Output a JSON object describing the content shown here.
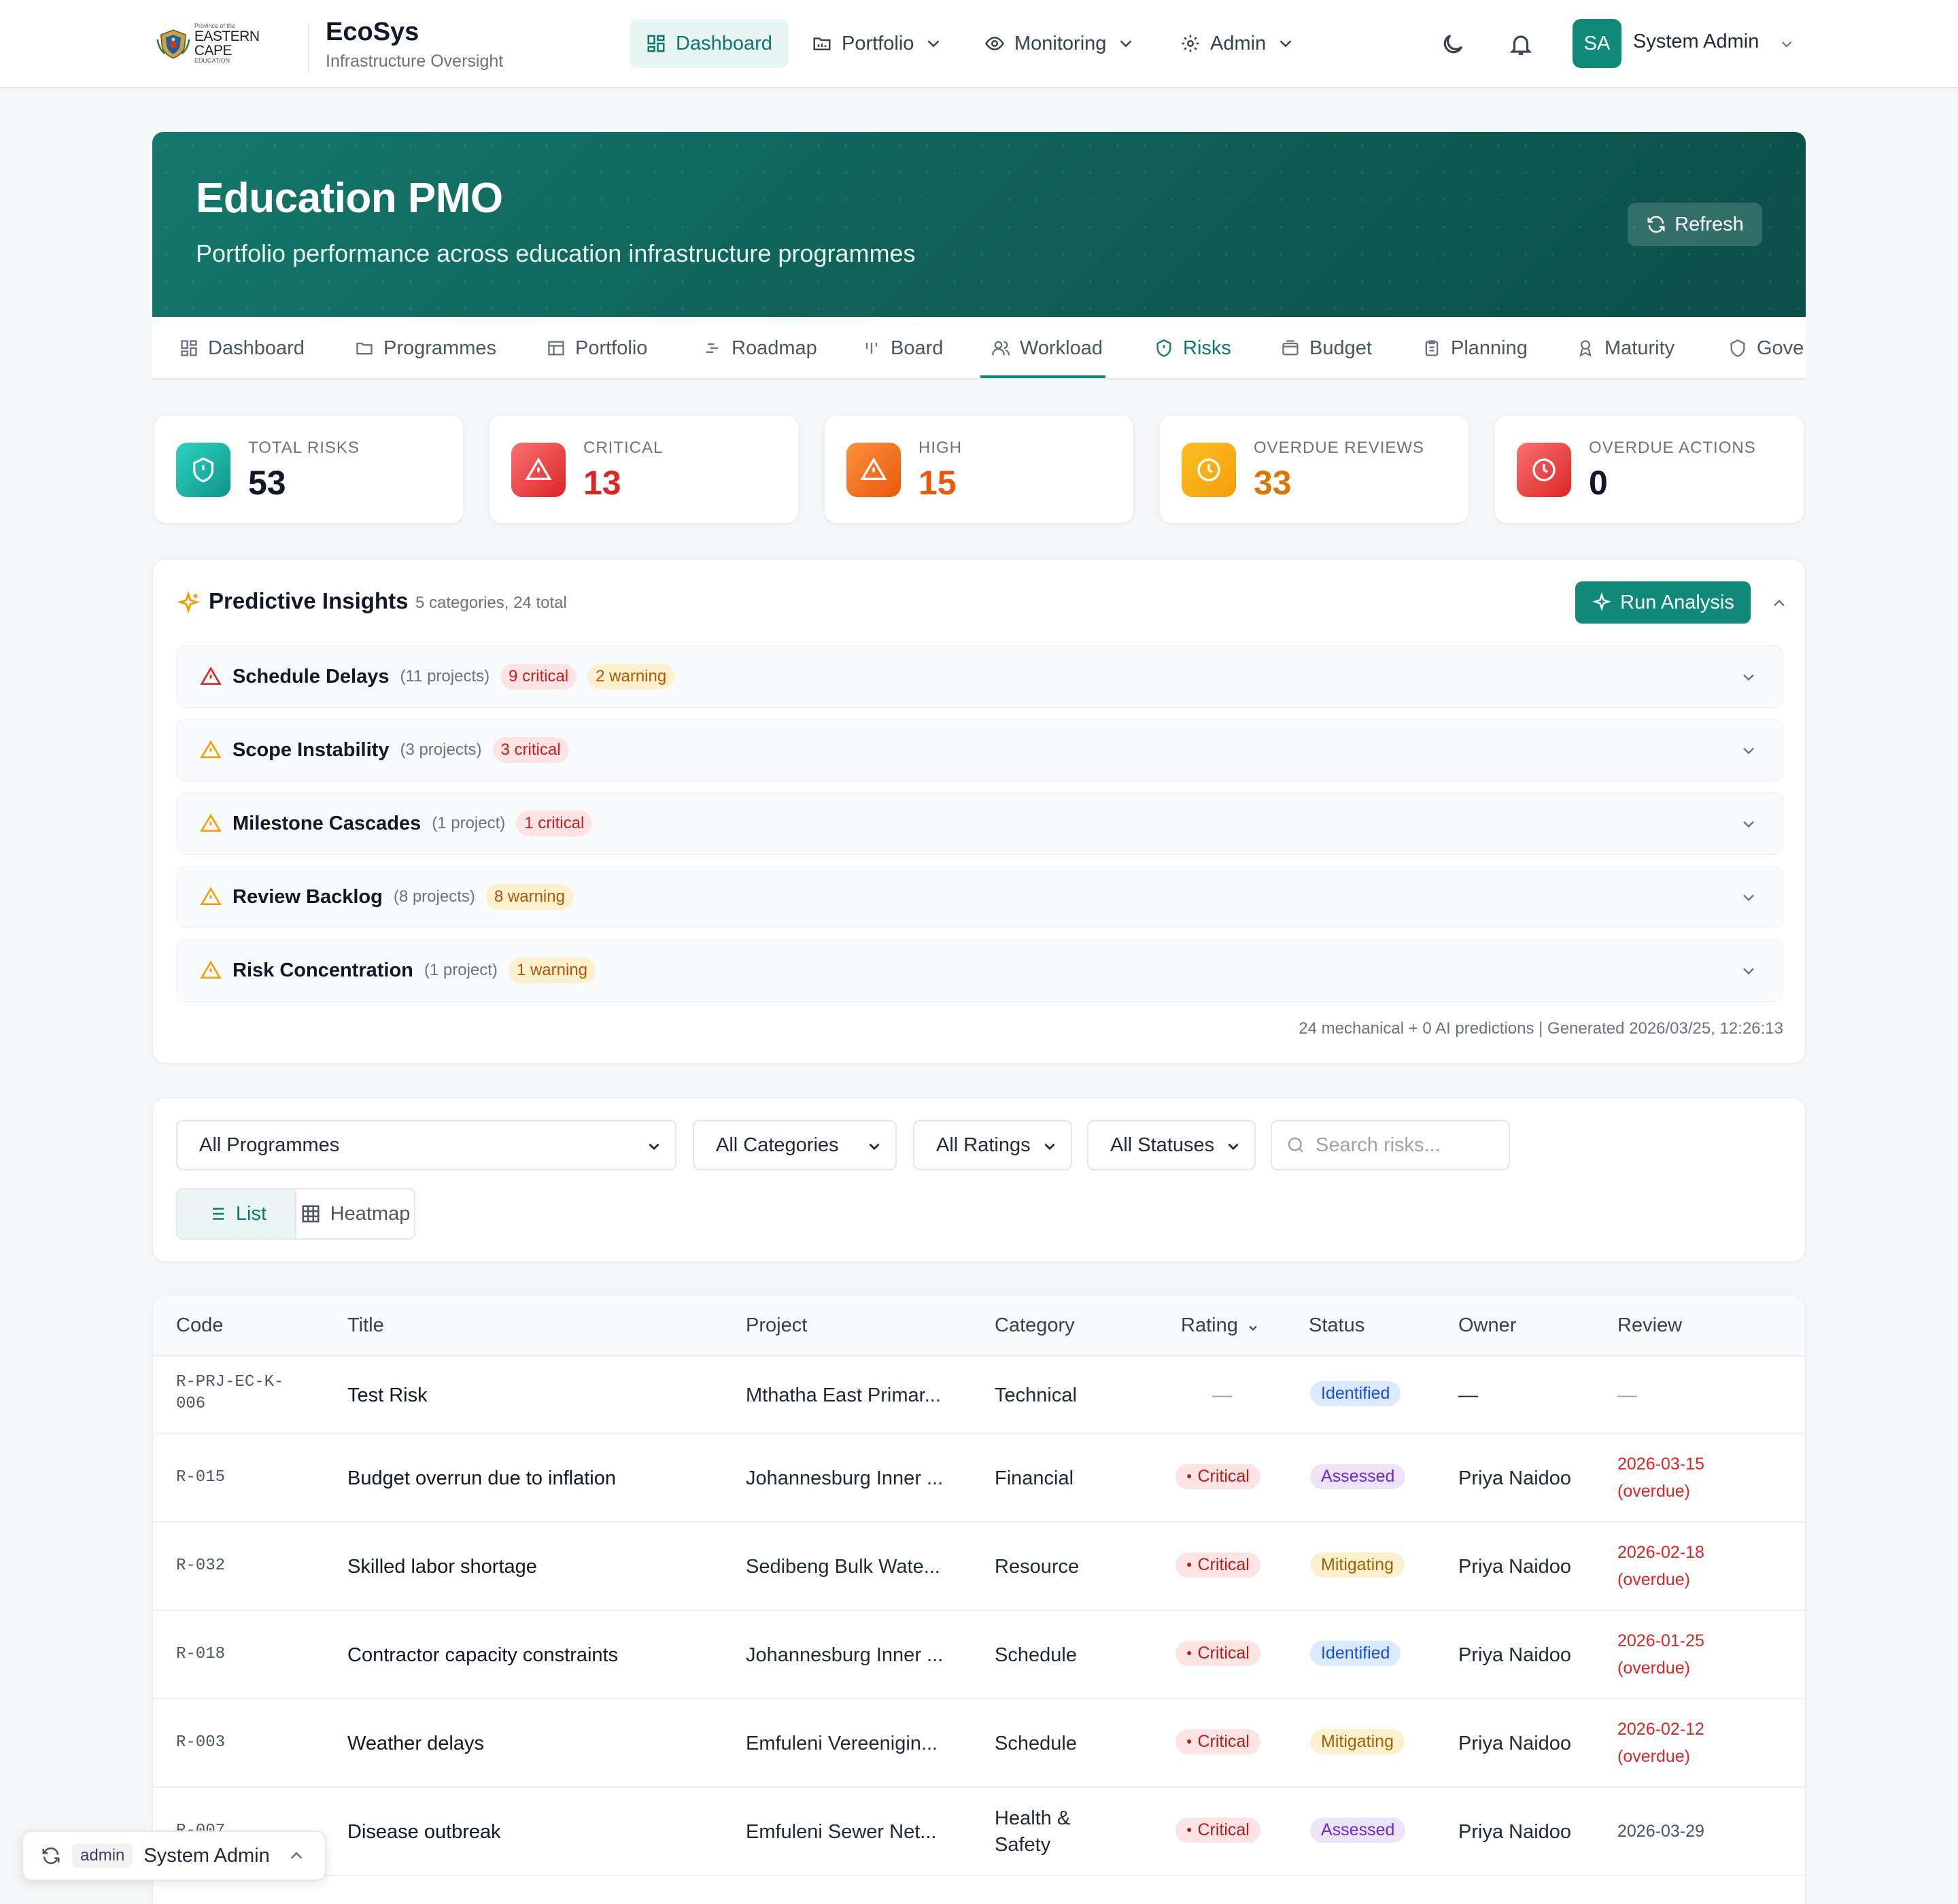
{
  "header": {
    "logo": {
      "line1": "Province of the",
      "line2": "EASTERN CAPE",
      "line3": "EDUCATION"
    },
    "brand": "EcoSys",
    "brand_sub": "Infrastructure Oversight",
    "nav": [
      {
        "label": "Dashboard",
        "icon": "grid-icon",
        "active": true
      },
      {
        "label": "Portfolio",
        "icon": "folder-icon"
      },
      {
        "label": "Monitoring",
        "icon": "eye-icon"
      },
      {
        "label": "Admin",
        "icon": "gear-icon"
      }
    ],
    "user": {
      "initials": "SA",
      "name": "System Admin"
    }
  },
  "hero": {
    "title": "Education PMO",
    "subtitle": "Portfolio performance across education infrastructure programmes",
    "refresh_label": "Refresh"
  },
  "subtabs": [
    {
      "label": "Dashboard",
      "icon": "grid-icon"
    },
    {
      "label": "Programmes",
      "icon": "folder-icon"
    },
    {
      "label": "Portfolio",
      "icon": "table-icon"
    },
    {
      "label": "Roadmap",
      "icon": "roadmap-icon"
    },
    {
      "label": "Board",
      "icon": "board-icon"
    },
    {
      "label": "Workload",
      "icon": "users-icon"
    },
    {
      "label": "Risks",
      "icon": "shield-icon",
      "active": true
    },
    {
      "label": "Budget",
      "icon": "wallet-icon"
    },
    {
      "label": "Planning",
      "icon": "clipboard-icon"
    },
    {
      "label": "Maturity",
      "icon": "award-icon"
    },
    {
      "label": "Gove",
      "icon": "shield-icon"
    }
  ],
  "stats": [
    {
      "label": "TOTAL RISKS",
      "value": "53",
      "color": "#14b8a6"
    },
    {
      "label": "CRITICAL",
      "value": "13",
      "color": "#ef4444"
    },
    {
      "label": "HIGH",
      "value": "15",
      "color": "#f97316"
    },
    {
      "label": "OVERDUE REVIEWS",
      "value": "33",
      "color": "#f59e0b"
    },
    {
      "label": "OVERDUE ACTIONS",
      "value": "0",
      "color": "#ef4444"
    }
  ],
  "insights": {
    "title": "Predictive Insights",
    "meta": "5 categories, 24 total",
    "run_label": "Run Analysis",
    "rows": [
      {
        "title": "Schedule Delays",
        "count": "(11 projects)",
        "critical": "9 critical",
        "warning": "2 warning",
        "severity": "critical"
      },
      {
        "title": "Scope Instability",
        "count": "(3 projects)",
        "critical": "3 critical",
        "warning": "",
        "severity": "warning"
      },
      {
        "title": "Milestone Cascades",
        "count": "(1 project)",
        "critical": "1 critical",
        "warning": "",
        "severity": "warning"
      },
      {
        "title": "Review Backlog",
        "count": "(8 projects)",
        "critical": "",
        "warning": "8 warning",
        "severity": "warning"
      },
      {
        "title": "Risk Concentration",
        "count": "(1 project)",
        "critical": "",
        "warning": "1 warning",
        "severity": "warning"
      }
    ],
    "footer": "24 mechanical + 0 AI predictions | Generated 2026/03/25, 12:26:13"
  },
  "filters": {
    "programme": "All Programmes",
    "category": "All Categories",
    "rating": "All Ratings",
    "status": "All Statuses",
    "search_placeholder": "Search risks...",
    "view_list": "List",
    "view_heatmap": "Heatmap"
  },
  "table": {
    "columns": [
      "Code",
      "Title",
      "Project",
      "Category",
      "Rating",
      "Status",
      "Owner",
      "Review"
    ],
    "rows": [
      {
        "code": "R-PRJ-EC-K-006",
        "title": "Test Risk",
        "project": "Mthatha East Primar...",
        "category": "Technical",
        "rating": "—",
        "status": "Identified",
        "owner": "—",
        "review": "—",
        "overdue": ""
      },
      {
        "code": "R-015",
        "title": "Budget overrun due to inflation",
        "project": "Johannesburg Inner ...",
        "category": "Financial",
        "rating": "Critical",
        "status": "Assessed",
        "owner": "Priya Naidoo",
        "review": "2026-03-15",
        "overdue": "(overdue)"
      },
      {
        "code": "R-032",
        "title": "Skilled labor shortage",
        "project": "Sedibeng Bulk Wate...",
        "category": "Resource",
        "rating": "Critical",
        "status": "Mitigating",
        "owner": "Priya Naidoo",
        "review": "2026-02-18",
        "overdue": "(overdue)"
      },
      {
        "code": "R-018",
        "title": "Contractor capacity constraints",
        "project": "Johannesburg Inner ...",
        "category": "Schedule",
        "rating": "Critical",
        "status": "Identified",
        "owner": "Priya Naidoo",
        "review": "2026-01-25",
        "overdue": "(overdue)"
      },
      {
        "code": "R-003",
        "title": "Weather delays",
        "project": "Emfuleni Vereenigin...",
        "category": "Schedule",
        "rating": "Critical",
        "status": "Mitigating",
        "owner": "Priya Naidoo",
        "review": "2026-02-12",
        "overdue": "(overdue)"
      },
      {
        "code": "R-007",
        "title": "Disease outbreak",
        "project": "Emfuleni Sewer Net...",
        "category": "Health & Safety",
        "rating": "Critical",
        "status": "Assessed",
        "owner": "Priya Naidoo",
        "review": "2026-03-29",
        "overdue": ""
      }
    ]
  },
  "chip": {
    "role": "admin",
    "name": "System Admin"
  }
}
